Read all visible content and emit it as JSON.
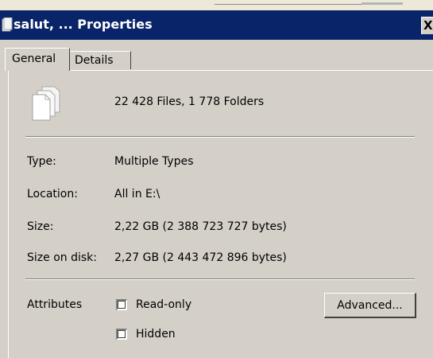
{
  "window": {
    "title": "salut, ... Properties",
    "close_glyph": "X"
  },
  "tabs": [
    {
      "label": "General",
      "selected": true
    },
    {
      "label": "Details",
      "selected": false
    }
  ],
  "summary": {
    "icon": "multiple-files-icon",
    "text": "22 428 Files, 1 778 Folders"
  },
  "properties": [
    {
      "label": "Type:",
      "value": "Multiple Types"
    },
    {
      "label": "Location:",
      "value": "All in E:\\"
    },
    {
      "label": "Size:",
      "value": "2,22 GB (2 388 723 727 bytes)"
    },
    {
      "label": "Size on disk:",
      "value": "2,27 GB (2 443 472 896 bytes)"
    }
  ],
  "attributes": {
    "label": "Attributes",
    "options": [
      {
        "label": "Read-only",
        "checked": false
      },
      {
        "label": "Hidden",
        "checked": false
      }
    ],
    "advanced_label": "Advanced..."
  },
  "colors": {
    "titlebar": "#0a246a",
    "dialog": "#d4d0c8"
  }
}
